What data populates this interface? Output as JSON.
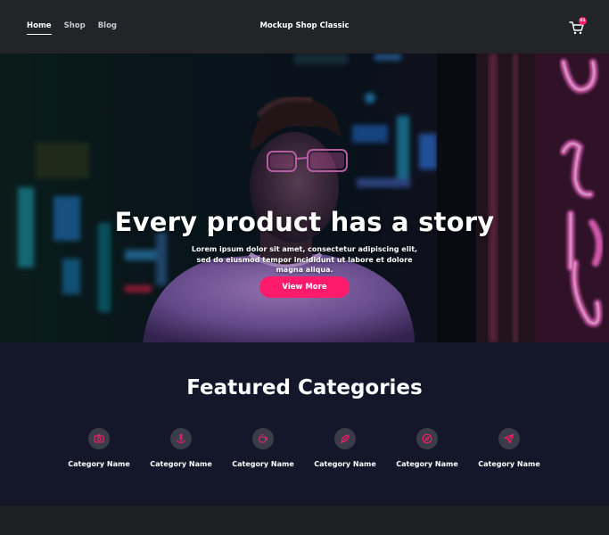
{
  "header": {
    "nav": [
      "Home",
      "Shop",
      "Blog"
    ],
    "brand": "Mockup Shop Classic",
    "cart_count": "01"
  },
  "hero": {
    "title": "Every product has a story",
    "text": "Lorem ipsum dolor sit amet, consectetur adipiscing elit, sed do eiusmod tempor incididunt ut labore et dolore magna aliqua.",
    "button": "View More"
  },
  "featured": {
    "title": "Featured Categories",
    "categories": [
      {
        "label": "Category Name",
        "icon": "camera-icon"
      },
      {
        "label": "Category Name",
        "icon": "anchor-icon"
      },
      {
        "label": "Category Name",
        "icon": "coffee-icon"
      },
      {
        "label": "Category Name",
        "icon": "feather-icon"
      },
      {
        "label": "Category Name",
        "icon": "compass-icon"
      },
      {
        "label": "Category Name",
        "icon": "send-icon"
      }
    ]
  },
  "colors": {
    "accent": "#ff1b6b",
    "header_bg": "#232428",
    "section_bg": "#141729"
  }
}
